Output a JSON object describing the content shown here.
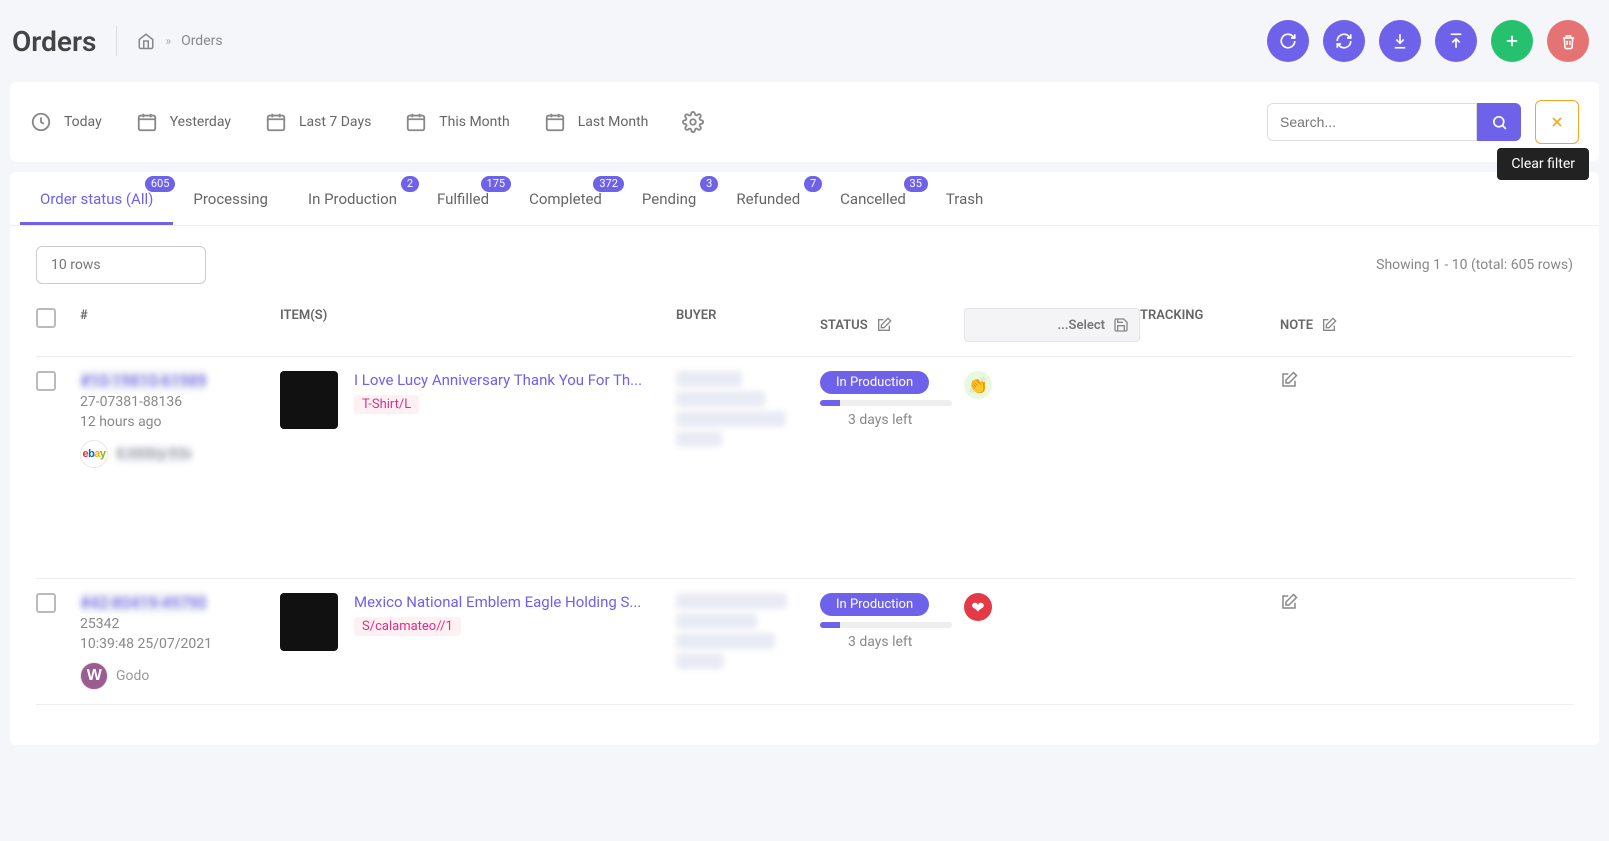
{
  "page": {
    "title": "Orders",
    "breadcrumb": "Orders"
  },
  "actions": {},
  "filters": {
    "today": "Today",
    "yesterday": "Yesterday",
    "last7": "Last 7 Days",
    "month": "This Month",
    "lastMonth": "Last Month"
  },
  "search": {
    "placeholder": "Search..."
  },
  "tooltip": {
    "clearFilter": "Clear filter"
  },
  "tabs": {
    "all": {
      "label": "Order status (All)",
      "badge": "605"
    },
    "processing": {
      "label": "Processing"
    },
    "inprod": {
      "label": "In Production",
      "badge": "2"
    },
    "fulfilled": {
      "label": "Fulfilled",
      "badge": "175"
    },
    "completed": {
      "label": "Completed",
      "badge": "372"
    },
    "pending": {
      "label": "Pending",
      "badge": "3"
    },
    "refunded": {
      "label": "Refunded",
      "badge": "7"
    },
    "cancelled": {
      "label": "Cancelled",
      "badge": "35"
    },
    "trash": {
      "label": "Trash"
    }
  },
  "meta": {
    "rowsSelect": "10 rows",
    "showing": "Showing 1 - 10 (total: 605 rows)"
  },
  "cols": {
    "hash": "#",
    "items": "ITEM(S)",
    "buyer": "BUYER",
    "status": "STATUS",
    "select": "...Select",
    "tracking": "TRACKING",
    "note": "NOTE"
  },
  "rows": [
    {
      "orderId": "#10-19810-61989",
      "sub1": "27-07381-88136",
      "sub2": "12 hours ago",
      "sourceLogo": "ebay",
      "sourceName": "8.it88by-93v",
      "itemTitle": "I Love Lucy Anniversary Thank You For Th...",
      "variant": "T-Shirt/L",
      "buyer1": "karlb-2298",
      "buyer2": "88 tintoh road,",
      "buyer3": "Henry Falls, 6436,",
      "buyer4": "NY - US",
      "status": "In Production",
      "deadline": "3 days left",
      "vendorClass": "v-green",
      "vendorGlyph": "👏"
    },
    {
      "orderId": "#42-80419-49790",
      "sub1": "25342",
      "sub2": "10:39:48 25/07/2021",
      "sourceLogo": "woo",
      "sourceName": "Godo",
      "itemTitle": "Mexico National Emblem Eagle Holding S...",
      "variant": "S/calamateo//1",
      "buyer1": "christof van avteo",
      "buyer2": "1376 marina,",
      "buyer3": "kuilsrivier, 7580,",
      "buyer4": "CH - ZA",
      "status": "In Production",
      "deadline": "3 days left",
      "vendorClass": "v-red",
      "vendorGlyph": "❤"
    }
  ]
}
